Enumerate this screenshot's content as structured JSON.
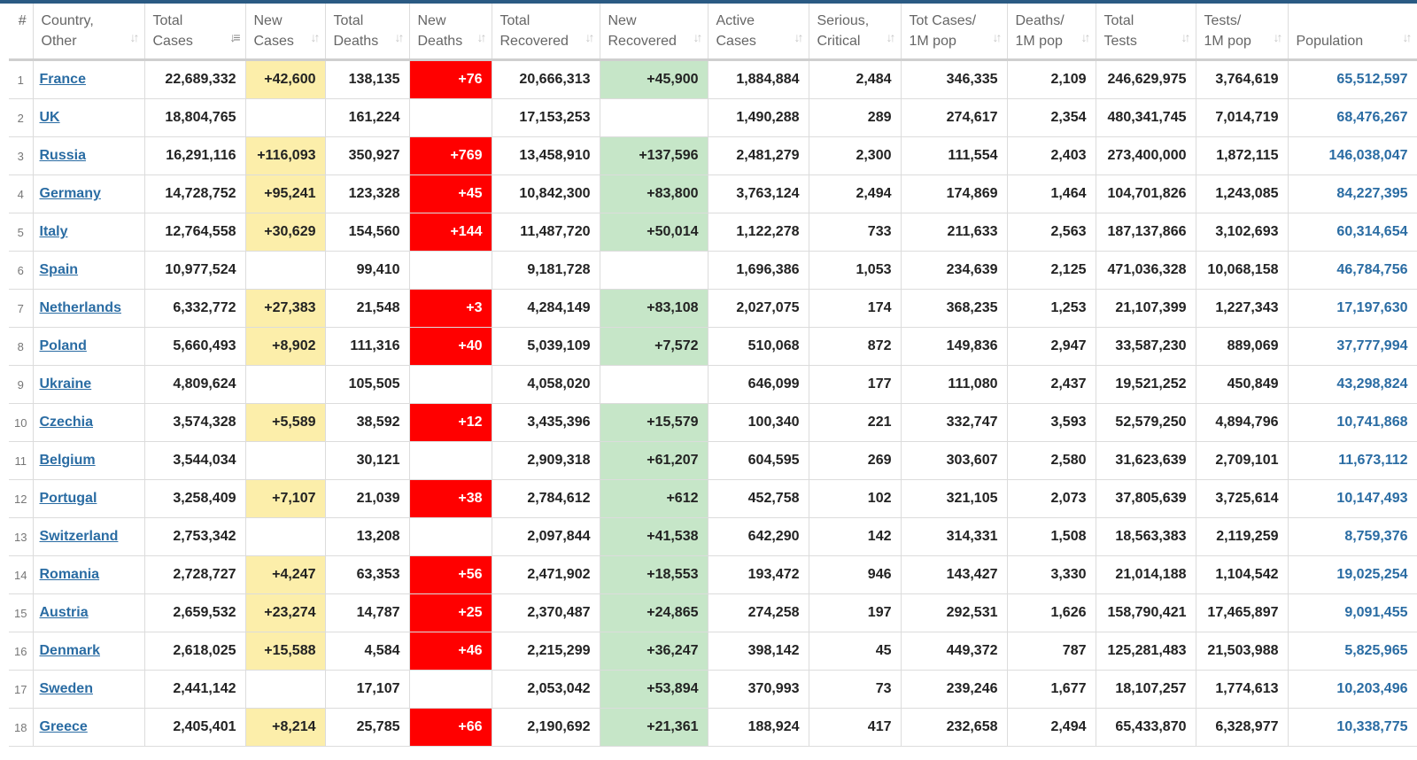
{
  "headers": [
    {
      "key": "idx",
      "lines": [
        "#",
        ""
      ]
    },
    {
      "key": "country",
      "lines": [
        "Country,",
        "Other"
      ]
    },
    {
      "key": "total_cases",
      "lines": [
        "Total",
        "Cases"
      ]
    },
    {
      "key": "new_cases",
      "lines": [
        "New",
        "Cases"
      ]
    },
    {
      "key": "total_deaths",
      "lines": [
        "Total",
        "Deaths"
      ]
    },
    {
      "key": "new_deaths",
      "lines": [
        "New",
        "Deaths"
      ]
    },
    {
      "key": "total_recovered",
      "lines": [
        "Total",
        "Recovered"
      ]
    },
    {
      "key": "new_recovered",
      "lines": [
        "New",
        "Recovered"
      ]
    },
    {
      "key": "active_cases",
      "lines": [
        "Active",
        "Cases"
      ]
    },
    {
      "key": "serious_critical",
      "lines": [
        "Serious,",
        "Critical"
      ]
    },
    {
      "key": "tot_cases_1m",
      "lines": [
        "Tot Cases/",
        "1M pop"
      ]
    },
    {
      "key": "deaths_1m",
      "lines": [
        "Deaths/",
        "1M pop"
      ]
    },
    {
      "key": "total_tests",
      "lines": [
        "Total",
        "Tests"
      ]
    },
    {
      "key": "tests_1m",
      "lines": [
        "Tests/",
        "1M pop"
      ]
    },
    {
      "key": "population",
      "lines": [
        "",
        "Population"
      ]
    }
  ],
  "sort_glyph": "↓↑",
  "active_sort_glyph": "↓≡",
  "rows": [
    [
      "1",
      "France",
      "22,689,332",
      "+42,600",
      "138,135",
      "+76",
      "20,666,313",
      "+45,900",
      "1,884,884",
      "2,484",
      "346,335",
      "2,109",
      "246,629,975",
      "3,764,619",
      "65,512,597"
    ],
    [
      "2",
      "UK",
      "18,804,765",
      "",
      "161,224",
      "",
      "17,153,253",
      "",
      "1,490,288",
      "289",
      "274,617",
      "2,354",
      "480,341,745",
      "7,014,719",
      "68,476,267"
    ],
    [
      "3",
      "Russia",
      "16,291,116",
      "+116,093",
      "350,927",
      "+769",
      "13,458,910",
      "+137,596",
      "2,481,279",
      "2,300",
      "111,554",
      "2,403",
      "273,400,000",
      "1,872,115",
      "146,038,047"
    ],
    [
      "4",
      "Germany",
      "14,728,752",
      "+95,241",
      "123,328",
      "+45",
      "10,842,300",
      "+83,800",
      "3,763,124",
      "2,494",
      "174,869",
      "1,464",
      "104,701,826",
      "1,243,085",
      "84,227,395"
    ],
    [
      "5",
      "Italy",
      "12,764,558",
      "+30,629",
      "154,560",
      "+144",
      "11,487,720",
      "+50,014",
      "1,122,278",
      "733",
      "211,633",
      "2,563",
      "187,137,866",
      "3,102,693",
      "60,314,654"
    ],
    [
      "6",
      "Spain",
      "10,977,524",
      "",
      "99,410",
      "",
      "9,181,728",
      "",
      "1,696,386",
      "1,053",
      "234,639",
      "2,125",
      "471,036,328",
      "10,068,158",
      "46,784,756"
    ],
    [
      "7",
      "Netherlands",
      "6,332,772",
      "+27,383",
      "21,548",
      "+3",
      "4,284,149",
      "+83,108",
      "2,027,075",
      "174",
      "368,235",
      "1,253",
      "21,107,399",
      "1,227,343",
      "17,197,630"
    ],
    [
      "8",
      "Poland",
      "5,660,493",
      "+8,902",
      "111,316",
      "+40",
      "5,039,109",
      "+7,572",
      "510,068",
      "872",
      "149,836",
      "2,947",
      "33,587,230",
      "889,069",
      "37,777,994"
    ],
    [
      "9",
      "Ukraine",
      "4,809,624",
      "",
      "105,505",
      "",
      "4,058,020",
      "",
      "646,099",
      "177",
      "111,080",
      "2,437",
      "19,521,252",
      "450,849",
      "43,298,824"
    ],
    [
      "10",
      "Czechia",
      "3,574,328",
      "+5,589",
      "38,592",
      "+12",
      "3,435,396",
      "+15,579",
      "100,340",
      "221",
      "332,747",
      "3,593",
      "52,579,250",
      "4,894,796",
      "10,741,868"
    ],
    [
      "11",
      "Belgium",
      "3,544,034",
      "",
      "30,121",
      "",
      "2,909,318",
      "+61,207",
      "604,595",
      "269",
      "303,607",
      "2,580",
      "31,623,639",
      "2,709,101",
      "11,673,112"
    ],
    [
      "12",
      "Portugal",
      "3,258,409",
      "+7,107",
      "21,039",
      "+38",
      "2,784,612",
      "+612",
      "452,758",
      "102",
      "321,105",
      "2,073",
      "37,805,639",
      "3,725,614",
      "10,147,493"
    ],
    [
      "13",
      "Switzerland",
      "2,753,342",
      "",
      "13,208",
      "",
      "2,097,844",
      "+41,538",
      "642,290",
      "142",
      "314,331",
      "1,508",
      "18,563,383",
      "2,119,259",
      "8,759,376"
    ],
    [
      "14",
      "Romania",
      "2,728,727",
      "+4,247",
      "63,353",
      "+56",
      "2,471,902",
      "+18,553",
      "193,472",
      "946",
      "143,427",
      "3,330",
      "21,014,188",
      "1,104,542",
      "19,025,254"
    ],
    [
      "15",
      "Austria",
      "2,659,532",
      "+23,274",
      "14,787",
      "+25",
      "2,370,487",
      "+24,865",
      "274,258",
      "197",
      "292,531",
      "1,626",
      "158,790,421",
      "17,465,897",
      "9,091,455"
    ],
    [
      "16",
      "Denmark",
      "2,618,025",
      "+15,588",
      "4,584",
      "+46",
      "2,215,299",
      "+36,247",
      "398,142",
      "45",
      "449,372",
      "787",
      "125,281,483",
      "21,503,988",
      "5,825,965"
    ],
    [
      "17",
      "Sweden",
      "2,441,142",
      "",
      "17,107",
      "",
      "2,053,042",
      "+53,894",
      "370,993",
      "73",
      "239,246",
      "1,677",
      "18,107,257",
      "1,774,613",
      "10,203,496"
    ],
    [
      "18",
      "Greece",
      "2,405,401",
      "+8,214",
      "25,785",
      "+66",
      "2,190,692",
      "+21,361",
      "188,924",
      "417",
      "232,658",
      "2,494",
      "65,433,870",
      "6,328,977",
      "10,338,775"
    ]
  ],
  "colors": {
    "new_cases_bg": "#fceeaa",
    "new_deaths_bg": "#ff0000",
    "new_recovered_bg": "#c6e6c8",
    "link": "#2a6ca3",
    "topbar": "#2a5a83"
  },
  "icons": {
    "sort": "sort-arrows-icon"
  }
}
